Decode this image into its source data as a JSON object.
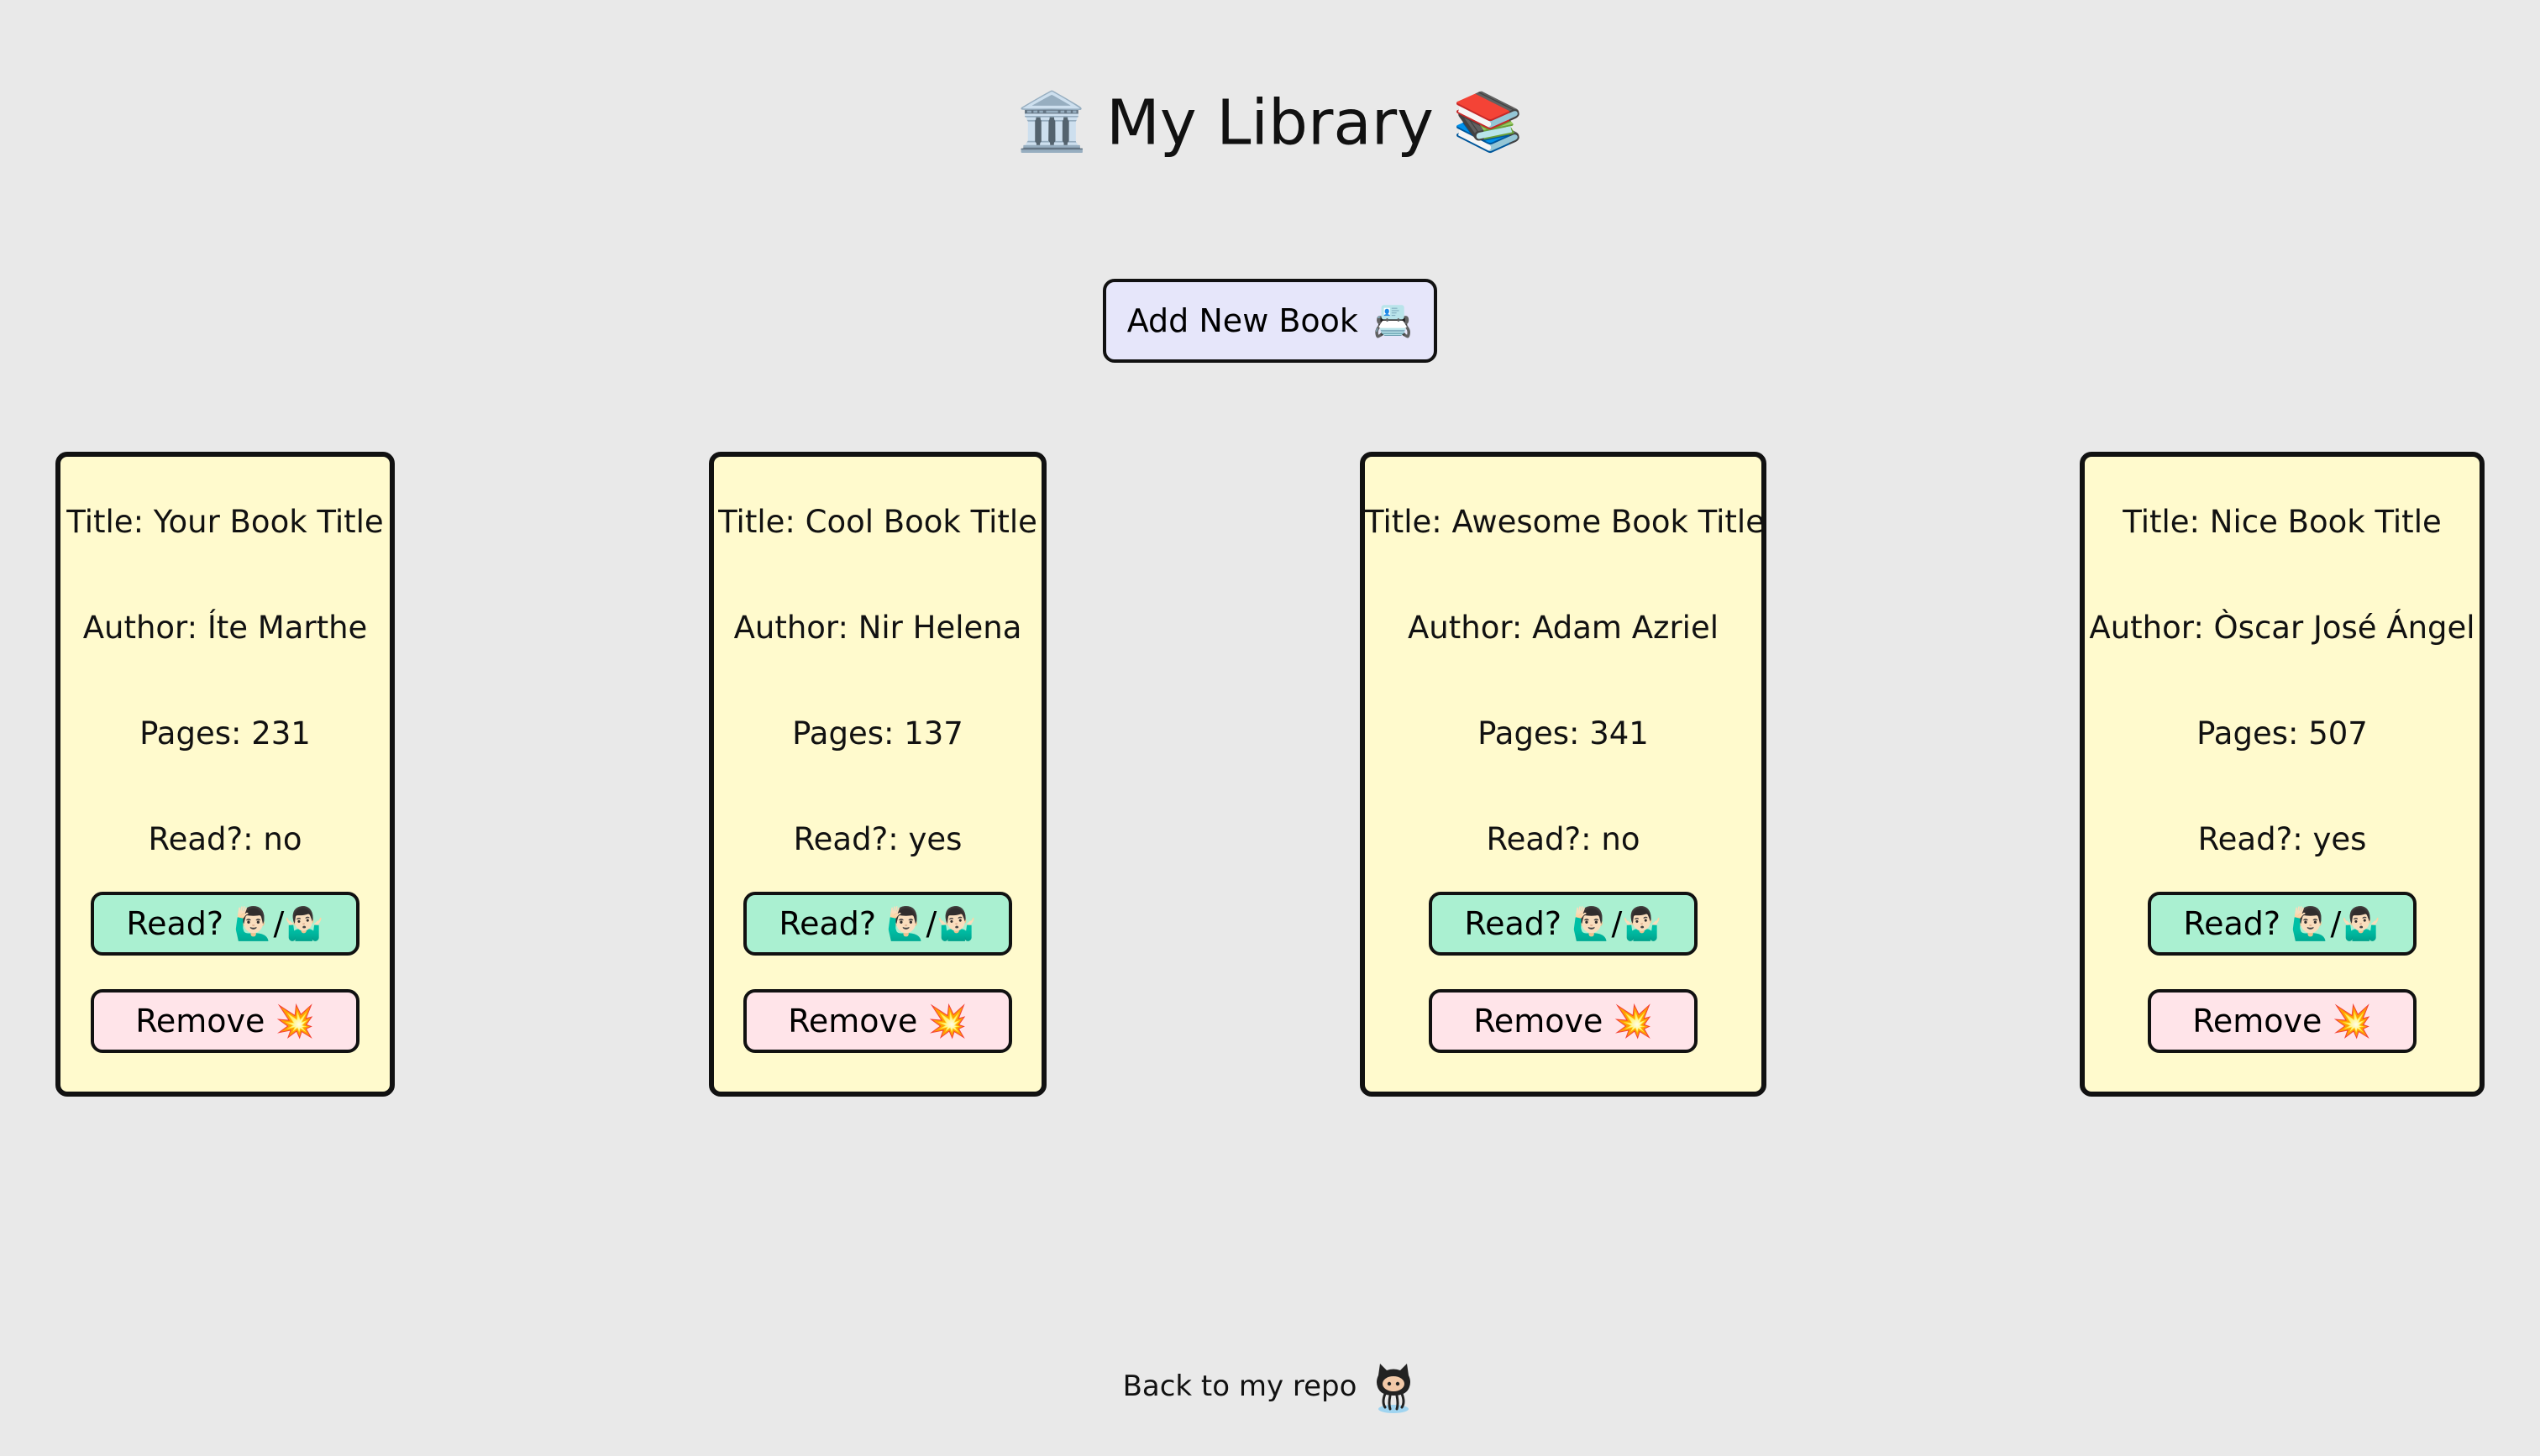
{
  "header": {
    "left_emoji": "🏛️",
    "title": "My Library",
    "right_emoji": "📚"
  },
  "add_button": {
    "label": "Add New Book",
    "emoji": "📇"
  },
  "books": [
    {
      "title": "Title: Your Book Title",
      "author": "Author: Íte Marthe",
      "pages": "Pages: 231",
      "read": "Read?: no",
      "read_button": "Read? 🙋🏻‍♂️/🤷🏻‍♂️",
      "remove_button": "Remove 💥"
    },
    {
      "title": "Title: Cool Book Title",
      "author": "Author: Nir Helena",
      "pages": "Pages: 137",
      "read": "Read?: yes",
      "read_button": "Read? 🙋🏻‍♂️/🤷🏻‍♂️",
      "remove_button": "Remove 💥"
    },
    {
      "title": "Title: Awesome Book Title",
      "author": "Author: Adam Azriel",
      "pages": "Pages: 341",
      "read": "Read?: no",
      "read_button": "Read? 🙋🏻‍♂️/🤷🏻‍♂️",
      "remove_button": "Remove 💥"
    },
    {
      "title": "Title: Nice Book Title",
      "author": "Author: Òscar José Ángel",
      "pages": "Pages: 507",
      "read": "Read?: yes",
      "read_button": "Read? 🙋🏻‍♂️/🤷🏻‍♂️",
      "remove_button": "Remove 💥"
    }
  ],
  "footer": {
    "link_text": "Back to my repo",
    "icon": "github-octocat-icon"
  },
  "colors": {
    "background": "#e9e9e9",
    "card": "#fffacd",
    "read_button": "#aaf0d1",
    "remove_button": "#ffe4e9",
    "add_button": "#e6e6fa"
  }
}
